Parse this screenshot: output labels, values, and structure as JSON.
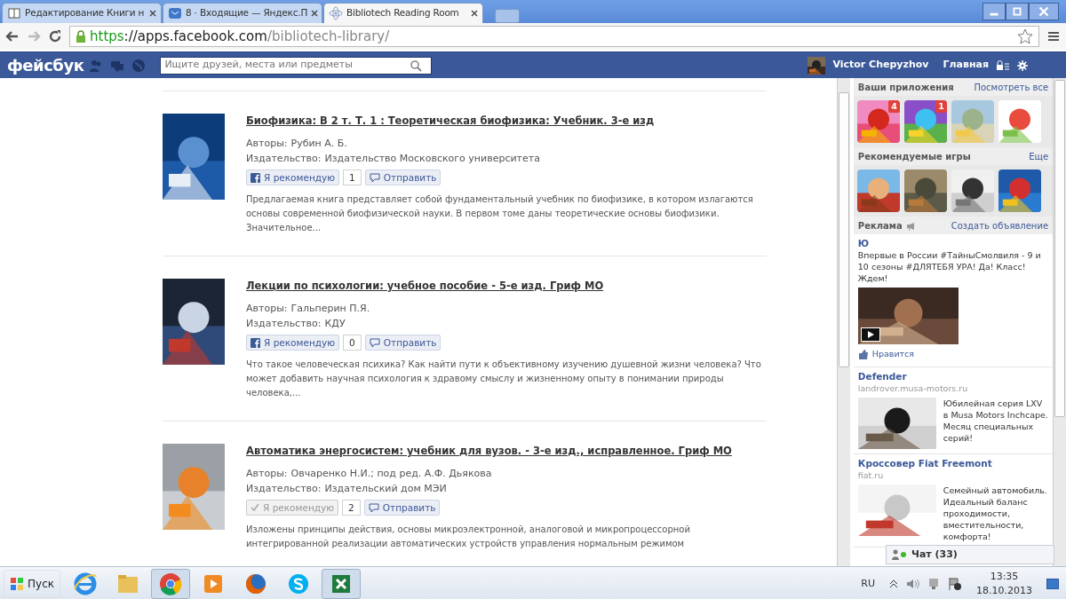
{
  "browser": {
    "tabs": [
      {
        "title": "Редактирование Книги н",
        "selected": false
      },
      {
        "title": "8 · Входящие — Яндекс.П",
        "selected": false
      },
      {
        "title": "Bibliotech Reading Room",
        "selected": true
      }
    ],
    "url": {
      "scheme": "https",
      "host": "://apps.facebook.com",
      "path": "/bibliotech-library/"
    }
  },
  "facebook_bar": {
    "logo": "фейсбук",
    "search": {
      "placeholder": "Ищите друзей, места или предметы"
    },
    "user": "Victor Chepyzhov",
    "home": "Главная"
  },
  "books": [
    {
      "title": "Биофизика: В 2 т. Т. 1 : Теоретическая биофизика: Учебник. 3-е изд",
      "authors_label": "Авторы:",
      "authors": "Рубин А. Б.",
      "publisher_label": "Издательство:",
      "publisher": "Издательство Московского университета",
      "recommend": {
        "label": "Я рекомендую",
        "count": "1",
        "recommended": false
      },
      "send": "Отправить",
      "description": "Предлагаемая книга представляет собой фундаментальный учебник по биофизике, в котором излагаются основы современной биофизической науки. В первом томе даны теоретические основы биофизики. Значительное..."
    },
    {
      "title": "Лекции по психологии: учебное пособие - 5-е изд. Гриф МО",
      "authors_label": "Авторы:",
      "authors": "Гальперин П.Я.",
      "publisher_label": "Издательство:",
      "publisher": "КДУ",
      "recommend": {
        "label": "Я рекомендую",
        "count": "0",
        "recommended": false
      },
      "send": "Отправить",
      "description": "Что такое человеческая психика? Как найти пути к объективному изучению душевной жизни человека? Что может добавить научная психология к здравому смыслу и жизненному опыту в понимании природы человека,..."
    },
    {
      "title": "Автоматика энергосистем: учебник для вузов. - 3-е изд., исправленное. Гриф МО",
      "authors_label": "Авторы:",
      "authors": "Овчаренко Н.И.; под ред. А.Ф. Дьякова",
      "publisher_label": "Издательство:",
      "publisher": "Издательский дом МЭИ",
      "recommend": {
        "label": "Я рекомендую",
        "count": "2",
        "recommended": true
      },
      "send": "Отправить",
      "description": "Изложены принципы действия, основы микроэлектронной, аналоговой и микропроцессорной интегрированной реализации автоматических устройств управления нормальным режимом"
    }
  ],
  "sidebar": {
    "apps": {
      "title": "Ваши приложения",
      "link": "Посмотреть все",
      "items": [
        {
          "kind": "picture",
          "badge": "4"
        },
        {
          "kind": "picture",
          "badge": "1"
        },
        {
          "kind": "picture"
        },
        {
          "kind": "picture"
        }
      ]
    },
    "games": {
      "title": "Рекомендуемые игры",
      "link": "Еще",
      "items": [
        {
          "kind": "picture"
        },
        {
          "kind": "picture"
        },
        {
          "kind": "picture"
        },
        {
          "kind": "picture"
        }
      ]
    },
    "ads": {
      "title": "Реклама",
      "link": "Создать объявление",
      "items": [
        {
          "kind": "video",
          "title": "Ю",
          "text": "Впервые в России #ТайныСмолвиля - 9 и 10 сезоны #ДЛЯТЕБЯ УРА! Да! Класс! Ждем!",
          "like": "Нравится"
        },
        {
          "kind": "side",
          "title": "Defender",
          "domain": "landrover.musa-motors.ru",
          "text": "Юбилейная серия LXV в Musa Motors Inchcape. Месяц специальных серий!"
        },
        {
          "kind": "side",
          "title": "Кроссовер Fiat Freemont",
          "domain": "fiat.ru",
          "text": "Семейный автомобиль. Идеальный баланс проходимости, вместительности, комфорта!"
        }
      ]
    },
    "chat": "Чат (33)"
  },
  "taskbar": {
    "start": "Пуск",
    "apps": [
      {
        "kind": "ie",
        "selected": false
      },
      {
        "kind": "folder",
        "selected": false
      },
      {
        "kind": "chrome",
        "selected": true
      },
      {
        "kind": "player",
        "selected": false
      },
      {
        "kind": "firefox",
        "selected": false
      },
      {
        "kind": "skype",
        "selected": false
      },
      {
        "kind": "excel",
        "selected": true
      }
    ],
    "language": "RU",
    "time": "13:35",
    "date": "18.10.2013"
  }
}
